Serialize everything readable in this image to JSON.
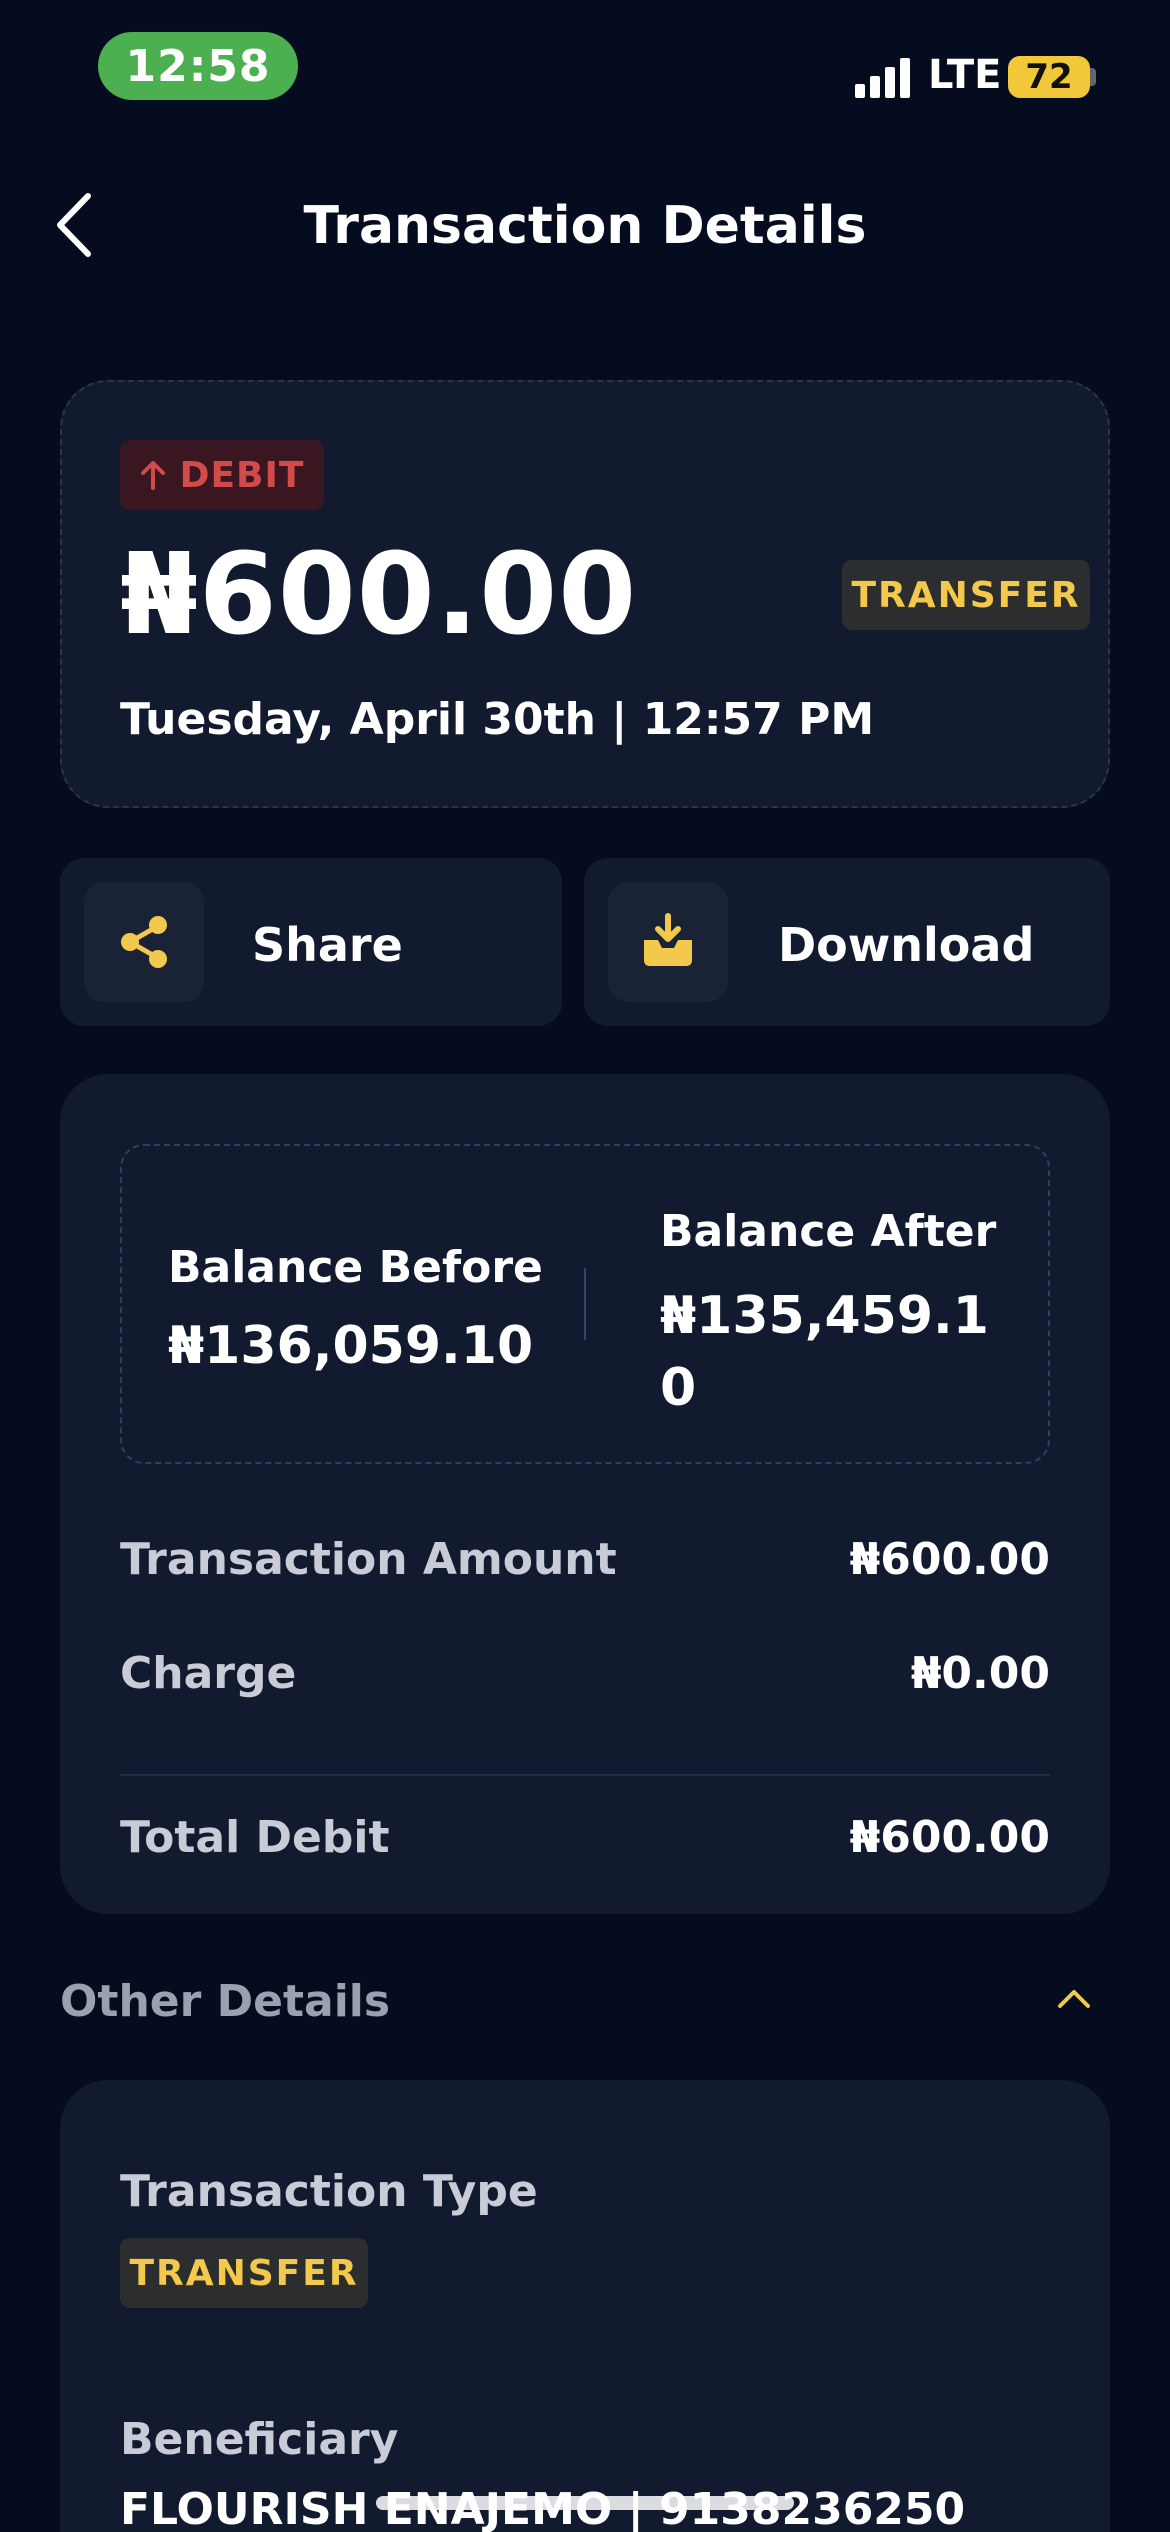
{
  "status_bar": {
    "time": "12:58",
    "network": "LTE",
    "battery": "72"
  },
  "header": {
    "title": "Transaction Details"
  },
  "summary": {
    "direction_label": "DEBIT",
    "amount": "₦600.00",
    "category": "TRANSFER",
    "datetime": "Tuesday, April 30th | 12:57 PM"
  },
  "actions": {
    "share": "Share",
    "download": "Download"
  },
  "balances": {
    "before_label": "Balance Before",
    "before_value": "₦136,059.10",
    "after_label": "Balance After",
    "after_value": "₦135,459.10"
  },
  "breakdown": [
    {
      "label": "Transaction Amount",
      "value": "₦600.00"
    },
    {
      "label": "Charge",
      "value": "₦0.00"
    },
    {
      "label": "Total Debit",
      "value": "₦600.00"
    }
  ],
  "other_details": {
    "title": "Other Details",
    "transaction_type_label": "Transaction Type",
    "transaction_type": "TRANSFER",
    "beneficiary_label": "Beneficiary",
    "beneficiary_value": "FLOURISH ENAJEMO | 9138236250"
  },
  "colors": {
    "background": "#050c1f",
    "card": "#111a2e",
    "accent": "#f2c94c",
    "debit": "#d24a4a",
    "time_pill": "#4caf50"
  }
}
